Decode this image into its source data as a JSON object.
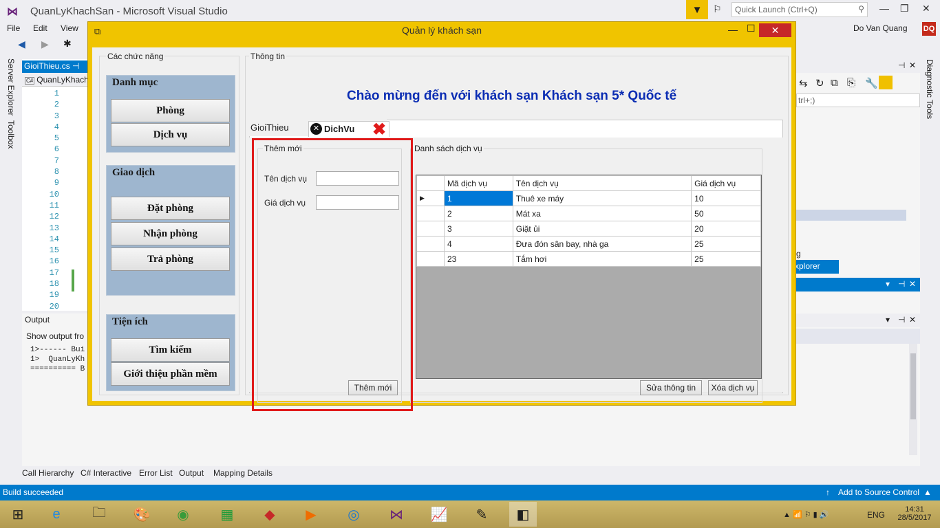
{
  "vs": {
    "title": "QuanLyKhachSan - Microsoft Visual Studio",
    "quick_launch": "Quick Launch (Ctrl+Q)",
    "user": "Do Van Quang",
    "user_badge": "DQ",
    "menu": [
      "File",
      "Edit",
      "View"
    ],
    "editor_tab": "GioiThieu.cs",
    "editor_sub": "QuanLyKhach",
    "line_numbers": [
      "1",
      "2",
      "3",
      "4",
      "5",
      "6",
      "7",
      "8",
      "9",
      "10",
      "11",
      "12",
      "13",
      "14",
      "15",
      "16",
      "17",
      "18",
      "19",
      "20"
    ],
    "side_tabs": [
      "Server Explorer",
      "Toolbox"
    ],
    "right_tabs": [
      "Diagnostic Tools"
    ],
    "output_title": "Output",
    "output_show": "Show output fro",
    "output_lines": "1>------ Bui\n1>  QuanLyKh\n========== B",
    "right_search": "trl+;)",
    "right_g": "g",
    "explorer_tab": "xplorer",
    "bottom_tabs": [
      "Call Hierarchy",
      "C# Interactive",
      "Error List",
      "Output",
      "Mapping Details"
    ],
    "status": "Build succeeded",
    "source_control": "Add to Source Control",
    "clock_time": "14:31",
    "clock_date": "28/5/2017",
    "lang": "ENG"
  },
  "form": {
    "title": "Quản lý khách sạn",
    "functions_label": "Các chức năng",
    "info_label": "Thông tin",
    "welcome": "Chào mừng đến với khách sạn Khách sạn 5* Quốc tế",
    "group1": {
      "title": "Danh mục",
      "buttons": [
        "Phòng",
        "Dịch vụ"
      ]
    },
    "group2": {
      "title": "Giao dịch",
      "buttons": [
        "Đặt phòng",
        "Nhận phòng",
        "Trả phòng"
      ]
    },
    "group3": {
      "title": "Tiện ích",
      "buttons": [
        "Tìm kiếm",
        "Giới thiệu phần mềm"
      ]
    },
    "tabs": [
      "GioiThieu",
      "DichVu"
    ],
    "add_group": {
      "title": "Thêm mới",
      "name_label": "Tên dịch vụ",
      "price_label": "Giá dịch vụ",
      "add_button": "Thêm mới"
    },
    "list_group": {
      "title": "Danh sách dịch vụ",
      "columns": [
        "Mã dịch vụ",
        "Tên dịch vụ",
        "Giá dịch vụ"
      ],
      "rows": [
        [
          "1",
          "Thuê xe máy",
          "10"
        ],
        [
          "2",
          "Mát xa",
          "50"
        ],
        [
          "3",
          "Giặt ủi",
          "20"
        ],
        [
          "4",
          "Đưa đón sân bay, nhà ga",
          "25"
        ],
        [
          "23",
          "Tắm hơi",
          "25"
        ]
      ],
      "edit_button": "Sửa thông tin",
      "delete_button": "Xóa dịch vụ"
    }
  },
  "colors": {
    "form_frame": "#f0c400",
    "accent": "#007acc",
    "highlight": "#e01a1a",
    "welcome": "#0b2db3",
    "group_bg": "#9eb6cf"
  }
}
